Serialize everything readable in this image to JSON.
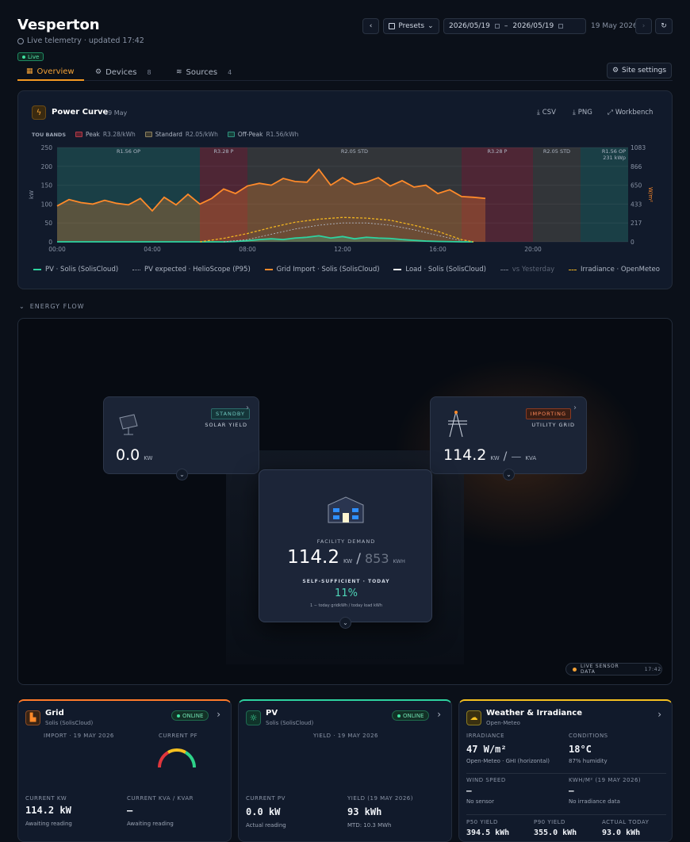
{
  "header": {
    "title": "Vesperton",
    "subtitle": "Live telemetry · updated 17:42",
    "live_badge": "Live",
    "presets_label": "Presets",
    "date_from": "2026/05/19",
    "date_to": "2026/05/19",
    "date_sep": "–",
    "current_date": "19 May 2026",
    "site_settings": "Site settings"
  },
  "tabs": [
    {
      "label": "Overview",
      "count": ""
    },
    {
      "label": "Devices",
      "count": "8"
    },
    {
      "label": "Sources",
      "count": "4"
    }
  ],
  "power_curve": {
    "title": "Power Curve",
    "date": "19 May",
    "csv": "CSV",
    "png": "PNG",
    "workbench": "Workbench",
    "tou_label": "TOU BANDS",
    "tou_bands": [
      {
        "name": "Peak",
        "rate": "R3.28/kWh",
        "color": "#b23a48"
      },
      {
        "name": "Standard",
        "rate": "R2.05/kWh",
        "color": "#8a8060"
      },
      {
        "name": "Off-Peak",
        "rate": "R1.56/kWh",
        "color": "#2f8f7f"
      }
    ],
    "band_tags": [
      "R1.56 OP",
      "R3.28 P",
      "R2.05 STD",
      "R3.28 P",
      "R2.05 STD",
      "R1.56 OP"
    ],
    "peak_annotation": "231 kWp",
    "left_axis_unit": "kW",
    "right_axis_unit": "W/m²"
  },
  "chart_data": {
    "type": "area",
    "x_ticks": [
      "00:00",
      "04:00",
      "08:00",
      "12:00",
      "16:00",
      "20:00"
    ],
    "y_ticks_left": [
      0,
      50,
      100,
      150,
      200,
      250
    ],
    "y_ticks_right": [
      0,
      217,
      433,
      650,
      866,
      1083
    ],
    "ylim_left": [
      0,
      250
    ],
    "ylim_right": [
      0,
      1083
    ],
    "x_range_hours": [
      0,
      24
    ],
    "bands": [
      {
        "from": 0,
        "to": 6,
        "type": "Off-Peak"
      },
      {
        "from": 6,
        "to": 8,
        "type": "Peak"
      },
      {
        "from": 8,
        "to": 17,
        "type": "Standard"
      },
      {
        "from": 17,
        "to": 20,
        "type": "Peak"
      },
      {
        "from": 20,
        "to": 22,
        "type": "Standard"
      },
      {
        "from": 22,
        "to": 24,
        "type": "Off-Peak"
      }
    ],
    "series": [
      {
        "name": "Grid Import · Solis (SolisCloud)",
        "color": "#ff8a2a",
        "x": [
          0,
          0.5,
          1,
          1.5,
          2,
          2.5,
          3,
          3.5,
          4,
          4.5,
          5,
          5.5,
          6,
          6.5,
          7,
          7.5,
          8,
          8.5,
          9,
          9.5,
          10,
          10.5,
          11,
          11.5,
          12,
          12.5,
          13,
          13.5,
          14,
          14.5,
          15,
          15.5,
          16,
          16.5,
          17,
          17.5,
          18
        ],
        "y": [
          95,
          112,
          104,
          100,
          110,
          102,
          98,
          115,
          82,
          118,
          98,
          126,
          100,
          115,
          140,
          128,
          148,
          155,
          150,
          168,
          160,
          158,
          192,
          150,
          170,
          152,
          158,
          170,
          148,
          162,
          145,
          150,
          128,
          138,
          120,
          118,
          115
        ]
      },
      {
        "name": "PV · Solis (SolisCloud)",
        "color": "#2ed3a0",
        "x": [
          0,
          6,
          7,
          7.5,
          8,
          8.5,
          9,
          9.5,
          10,
          10.5,
          11,
          11.5,
          12,
          12.5,
          13,
          13.5,
          14,
          14.5,
          15,
          15.5,
          16,
          16.5,
          17,
          17.5
        ],
        "y": [
          0,
          0,
          0,
          1,
          3,
          6,
          8,
          6,
          10,
          12,
          16,
          10,
          14,
          8,
          12,
          10,
          9,
          6,
          4,
          2,
          1,
          0.5,
          0,
          0
        ]
      },
      {
        "name": "Irradiance · OpenMeteo",
        "color": "#f0b420",
        "x": [
          6,
          7,
          8,
          9,
          10,
          11,
          12,
          13,
          14,
          15,
          16,
          17,
          17.5
        ],
        "y": [
          0,
          40,
          95,
          165,
          225,
          260,
          280,
          272,
          248,
          190,
          120,
          25,
          0
        ]
      },
      {
        "name": "PV expected · HelioScope (P95)",
        "color": "#b0b6c2",
        "x": [
          7,
          8,
          9,
          10,
          11,
          12,
          13,
          14,
          15,
          16,
          17
        ],
        "y": [
          0,
          6,
          20,
          34,
          44,
          50,
          50,
          44,
          32,
          17,
          3
        ]
      }
    ],
    "legend": [
      {
        "label": "PV · Solis (SolisCloud)",
        "color": "#2ed3a0",
        "style": "solid"
      },
      {
        "label": "PV expected · HelioScope (P95)",
        "color": "#9aa0aa",
        "style": "dotted"
      },
      {
        "label": "Grid Import · Solis (SolisCloud)",
        "color": "#ff8a2a",
        "style": "solid"
      },
      {
        "label": "Load · Solis (SolisCloud)",
        "color": "#ffffff",
        "style": "solid"
      },
      {
        "label": "vs Yesterday",
        "color": "#6a7282",
        "style": "dashed"
      },
      {
        "label": "Irradiance · OpenMeteo",
        "color": "#f0b420",
        "style": "dashed"
      }
    ]
  },
  "energy_flow": {
    "section_label": "ENERGY FLOW",
    "solar": {
      "badge": "STANDBY",
      "title": "SOLAR YIELD",
      "value": "0.0",
      "unit": "KW"
    },
    "grid": {
      "badge": "IMPORTING",
      "title": "UTILITY GRID",
      "value": "114.2",
      "unit": "KW",
      "sep": "/",
      "kva": "—",
      "kva_unit": "KVA"
    },
    "facility": {
      "title": "FACILITY DEMAND",
      "value": "114.2",
      "unit": "KW",
      "sep": "/",
      "energy": "853",
      "energy_unit": "KWH",
      "ss_label": "SELF-SUFFICIENT · TODAY",
      "ss_value": "11%",
      "ss_note": "1 − today gridkWh / today load kWh"
    },
    "live_sensor": "LIVE SENSOR DATA",
    "live_time": "17:42"
  },
  "cards": {
    "grid": {
      "title": "Grid",
      "source": "Solis (SolisCloud)",
      "status": "ONLINE",
      "import_label": "IMPORT · 19 MAY 2026",
      "pf_label": "CURRENT PF",
      "kw_label": "CURRENT KW",
      "kw_value": "114.2 kW",
      "kw_note": "Awaiting reading",
      "kva_label": "CURRENT KVA / KVAR",
      "kva_value": "—",
      "kva_note": "Awaiting reading"
    },
    "pv": {
      "title": "PV",
      "source": "Solis (SolisCloud)",
      "status": "ONLINE",
      "yield_label": "YIELD · 19 MAY 2026",
      "pv_label": "CURRENT PV",
      "pv_value": "0.0 kW",
      "pv_note": "Actual reading",
      "yd_label": "YIELD (19 MAY 2026)",
      "yd_value": "93 kWh",
      "yd_note": "MTD: 10.3 MWh"
    },
    "weather": {
      "title": "Weather & Irradiance",
      "source": "Open-Meteo",
      "irr_label": "IRRADIANCE",
      "irr_value": "47 W/m²",
      "irr_note": "Open-Meteo · GHI (horizontal)",
      "cond_label": "CONDITIONS",
      "cond_value": "18°C",
      "cond_note": "87% humidity",
      "wind_label": "WIND SPEED",
      "wind_value": "—",
      "wind_note": "No sensor",
      "kwh_label": "KWH/M² (19 MAY 2026)",
      "kwh_value": "—",
      "kwh_note": "No irradiance data",
      "p50_label": "P50 YIELD",
      "p50_value": "394.5 kWh",
      "p90_label": "P90 YIELD",
      "p90_value": "355.0 kWh",
      "act_label": "ACTUAL TODAY",
      "act_value": "93.0 kWh"
    }
  }
}
